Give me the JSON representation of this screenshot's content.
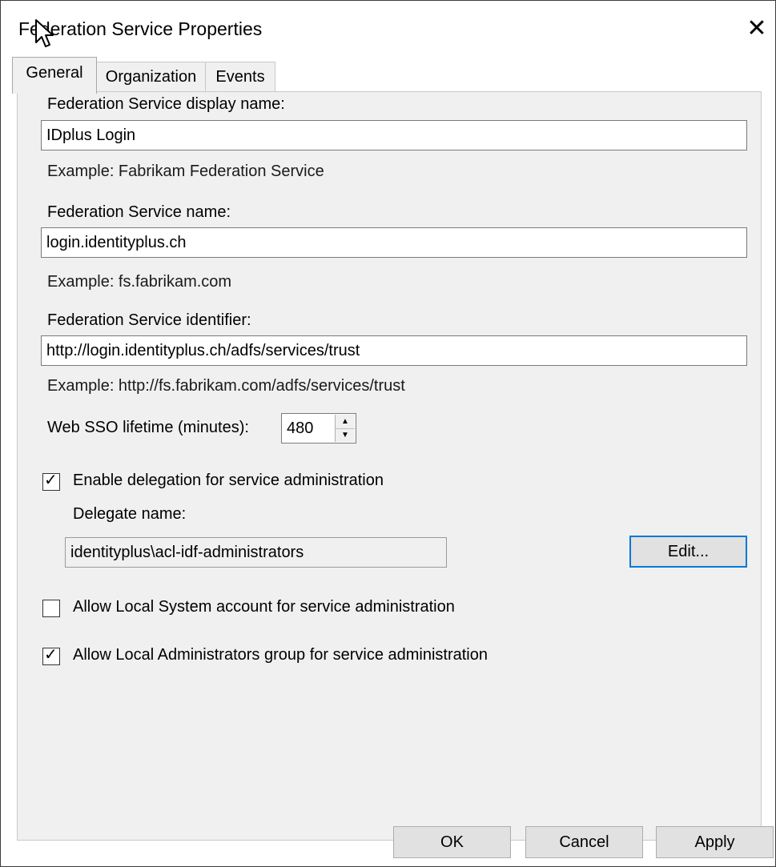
{
  "window": {
    "title": "Federation Service Properties",
    "close_glyph": "✕"
  },
  "tabs": [
    {
      "label": "General",
      "active": true
    },
    {
      "label": "Organization",
      "active": false
    },
    {
      "label": "Events",
      "active": false
    }
  ],
  "general": {
    "display_name_label": "Federation Service display name:",
    "display_name_value": "IDplus Login",
    "display_name_example": "Example: Fabrikam Federation Service",
    "service_name_label": "Federation Service name:",
    "service_name_value": "login.identityplus.ch",
    "service_name_example": "Example: fs.fabrikam.com",
    "identifier_label": "Federation Service identifier:",
    "identifier_value": "http://login.identityplus.ch/adfs/services/trust",
    "identifier_example": "Example: http://fs.fabrikam.com/adfs/services/trust",
    "sso_label": "Web SSO lifetime (minutes):",
    "sso_value": "480",
    "enable_delegation_label": "Enable delegation for service administration",
    "enable_delegation_checked": true,
    "delegate_name_label": "Delegate name:",
    "delegate_name_value": "identityplus\\acl-idf-administrators",
    "edit_button": "Edit...",
    "allow_local_system_label": "Allow Local System account for service administration",
    "allow_local_system_checked": false,
    "allow_local_admins_label": "Allow Local Administrators group for service administration",
    "allow_local_admins_checked": true
  },
  "footer": {
    "ok": "OK",
    "cancel": "Cancel",
    "apply": "Apply"
  }
}
